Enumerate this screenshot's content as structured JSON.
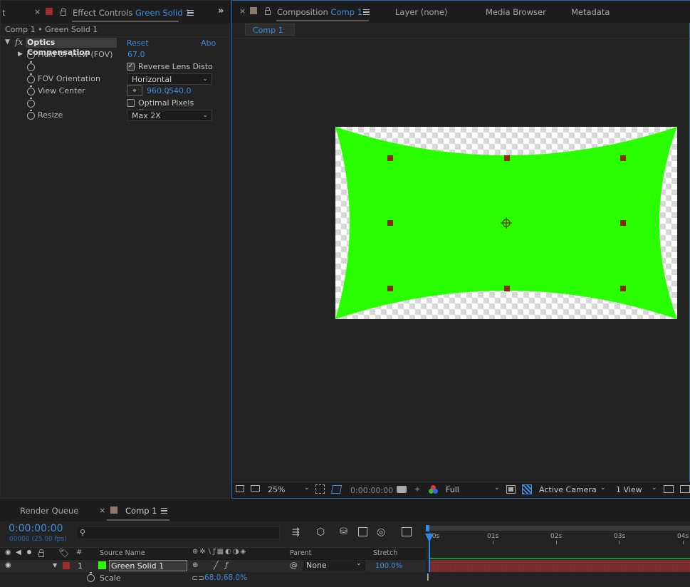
{
  "effect_panel": {
    "tab_partial": "t",
    "tab_title": "Effect Controls",
    "tab_layer": "Green Solid 1",
    "breadcrumb": "Comp 1 • Green Solid 1",
    "effect_name": "Optics Compensation",
    "fx_label": "fx",
    "reset": "Reset",
    "about": "Abo",
    "props": [
      {
        "label": "Field Of View (FOV)",
        "value": "67.0"
      },
      {
        "label": "",
        "value": "Reverse Lens Disto",
        "checked": true
      },
      {
        "label": "FOV Orientation",
        "value": "Horizontal"
      },
      {
        "label": "View Center",
        "value_x": "960.0",
        "value_y": "540.0"
      },
      {
        "label": "",
        "value": "Optimal Pixels (Inva",
        "checked": false
      },
      {
        "label": "Resize",
        "value": "Max 2X"
      }
    ],
    "comma": ","
  },
  "comp_panel": {
    "tab_title": "Composition",
    "tab_name": "Comp 1",
    "tabs": [
      "Layer (none)",
      "Media Browser",
      "Metadata"
    ],
    "subtab": "Comp 1",
    "bottom_bar": {
      "zoom": "25%",
      "timecode": "0:00:00:00",
      "resolution": "Full",
      "camera": "Active Camera",
      "views": "1 View"
    },
    "colors": {
      "solid": "#2aff00",
      "handle": "#8b2a10"
    }
  },
  "timeline": {
    "render_queue": "Render Queue",
    "tab_name": "Comp 1",
    "timecode": "0:00:00:00",
    "fps": "00000 (25.00 fps)",
    "ruler": [
      "00s",
      "01s",
      "02s",
      "03s",
      "04s"
    ],
    "columns": {
      "hash": "#",
      "source": "Source Name",
      "parent": "Parent",
      "stretch": "Stretch"
    },
    "layer": {
      "number": "1",
      "name": "Green Solid 1",
      "parent": "None",
      "stretch": "100.0%"
    },
    "scale_label": "Scale",
    "scale_value": "68.0,68.0%",
    "colors": {
      "layer_bar": "#7d2d2d",
      "accent": "#2d8ceb"
    }
  }
}
